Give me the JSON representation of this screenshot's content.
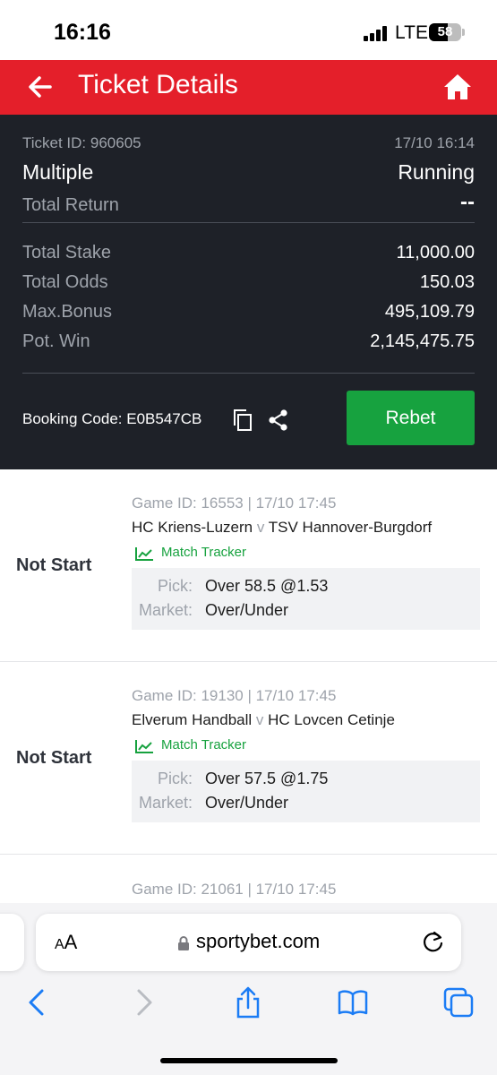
{
  "status_bar": {
    "time": "16:16",
    "network": "LTE",
    "battery": "58",
    "battery_level_percent": 58
  },
  "header": {
    "title": "Ticket Details"
  },
  "ticket": {
    "id": "Ticket ID: 960605",
    "time": "17/10 16:14",
    "type": "Multiple",
    "status": "Running",
    "total_return_label": "Total Return",
    "total_return_value": "--",
    "rows": [
      {
        "label": "Total Stake",
        "value": "11,000.00"
      },
      {
        "label": "Total Odds",
        "value": "150.03"
      },
      {
        "label": "Max.Bonus",
        "value": "495,109.79"
      },
      {
        "label": "Pot. Win",
        "value": "2,145,475.75"
      }
    ],
    "booking_code": "Booking Code: E0B547CB",
    "rebet_label": "Rebet"
  },
  "bets": [
    {
      "status": "Not Start",
      "meta": "Game ID: 16553 | 17/10 17:45",
      "home": "HC Kriens-Luzern",
      "vs": "v",
      "away": "TSV Hannover-Burgdorf",
      "tracker": "Match Tracker",
      "pick_label": "Pick:",
      "pick_value": "Over 58.5 @1.53",
      "market_label": "Market:",
      "market_value": "Over/Under"
    },
    {
      "status": "Not Start",
      "meta": "Game ID: 19130 | 17/10 17:45",
      "home": "Elverum Handball",
      "vs": "v",
      "away": "HC Lovcen Cetinje",
      "tracker": "Match Tracker",
      "pick_label": "Pick:",
      "pick_value": "Over 57.5 @1.75",
      "market_label": "Market:",
      "market_value": "Over/Under"
    },
    {
      "meta": "Game ID: 21061 | 17/10 17:45"
    }
  ],
  "browser": {
    "text_size": "AA",
    "url": "sportybet.com"
  },
  "colors": {
    "brand_red": "#e41f2a",
    "panel_dark": "#1e2128",
    "rebet_green": "#17a23f",
    "tracker_green": "#17a23f"
  }
}
